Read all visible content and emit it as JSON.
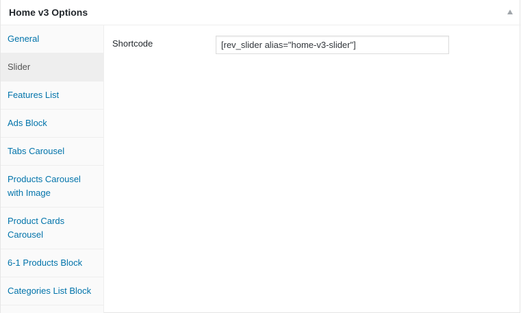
{
  "header": {
    "title": "Home v3 Options"
  },
  "sidebar": {
    "items": [
      {
        "label": "General"
      },
      {
        "label": "Slider"
      },
      {
        "label": "Features List"
      },
      {
        "label": "Ads Block"
      },
      {
        "label": "Tabs Carousel"
      },
      {
        "label": "Products Carousel with Image"
      },
      {
        "label": "Product Cards Carousel"
      },
      {
        "label": "6-1 Products Block"
      },
      {
        "label": "Categories List Block"
      }
    ],
    "active": "Slider"
  },
  "main": {
    "shortcode_label": "Shortcode",
    "shortcode_value": "[rev_slider alias=\"home-v3-slider\"]"
  }
}
